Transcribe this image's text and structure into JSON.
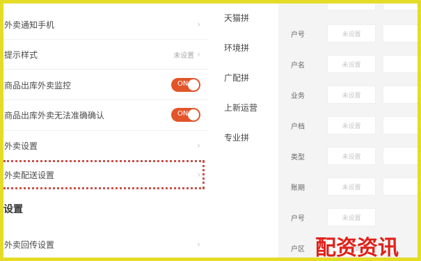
{
  "settings": {
    "row1": "外卖通知手机",
    "row2": "提示样式",
    "row2_value": "未设置",
    "row3": "商品出库外卖监控",
    "row4": "商品出库外卖无法准确确认",
    "toggle_on": "ON",
    "row5": "外卖设置",
    "row6": "外卖配送设置",
    "section_title": "设置",
    "row7": "外卖回传设置"
  },
  "middle_list": [
    "天猫拼",
    "环境拼",
    "广配拼",
    "上新运营",
    "专业拼"
  ],
  "grid": {
    "labels": [
      "户号",
      "户名",
      "业务",
      "户档",
      "类型",
      "账期",
      "户号",
      "户区"
    ],
    "cell_text": "未设置"
  },
  "watermark": "配资资讯",
  "colors": {
    "accent": "#e2552a",
    "border": "#e4dc26",
    "watermark": "#e0201a"
  }
}
